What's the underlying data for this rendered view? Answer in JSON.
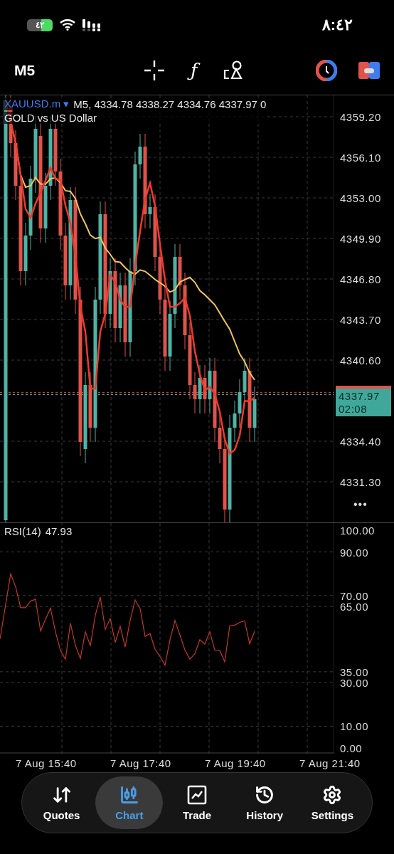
{
  "status_bar": {
    "battery": "٤٢",
    "time": "٨:٤٢"
  },
  "toolbar": {
    "timeframe": "M5",
    "indicator_glyph": "ƒ"
  },
  "chart": {
    "symbol": "XAUUSD.m",
    "symbol_caret": "▾",
    "ohlc": "M5, 4334.78 4338.27 4334.76 4337.97 0",
    "description": "GOLD vs US Dollar",
    "price_labels": [
      "4359.20",
      "4356.10",
      "4353.00",
      "4349.90",
      "4346.80",
      "4343.70",
      "4340.60",
      "4334.40",
      "4331.30"
    ],
    "current_price": "4337.97",
    "countdown": "02:08",
    "more": "•••"
  },
  "rsi": {
    "label": "RSI(14)",
    "value": "47.93",
    "levels": [
      "100.00",
      "90.00",
      "70.00",
      "65.00",
      "35.00",
      "30.00",
      "10.00",
      "0.00"
    ]
  },
  "time_labels": [
    "7 Aug 15:40",
    "7 Aug 17:40",
    "7 Aug 19:40",
    "7 Aug 21:40"
  ],
  "tabs": [
    {
      "label": "Quotes",
      "selected": false
    },
    {
      "label": "Chart",
      "selected": true
    },
    {
      "label": "Trade",
      "selected": false
    },
    {
      "label": "History",
      "selected": false
    },
    {
      "label": "Settings",
      "selected": false
    }
  ]
}
